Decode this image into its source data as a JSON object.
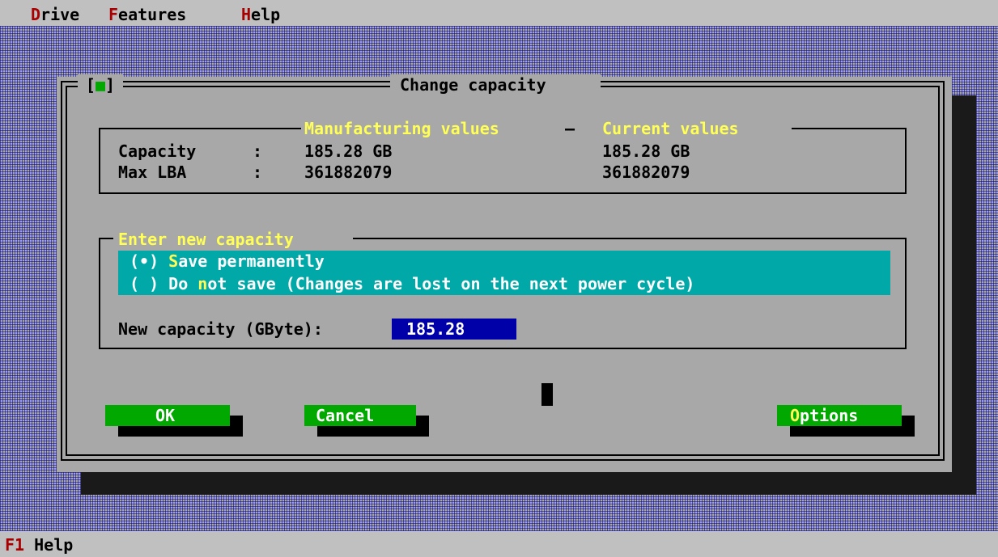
{
  "menu": {
    "drive": {
      "hot": "D",
      "rest": "rive"
    },
    "features": {
      "hot": "F",
      "rest": "eatures"
    },
    "help": {
      "hot": "H",
      "rest": "elp"
    }
  },
  "dialog": {
    "title": "Change capacity",
    "close_open": "[",
    "close_dot": "■",
    "close_close": "]",
    "info": {
      "col_manufacturing": "Manufacturing values",
      "col_separator": "—",
      "col_current": "Current values",
      "rows": [
        {
          "label": "Capacity",
          "sep": ":",
          "manufacturing": "185.28 GB",
          "current": "185.28 GB"
        },
        {
          "label": "Max LBA",
          "sep": ":",
          "manufacturing": "361882079",
          "current": "361882079"
        }
      ]
    },
    "entry": {
      "legend": "Enter new capacity",
      "options": [
        {
          "mark": "(•)",
          "hot": "S",
          "pre": "",
          "rest": "ave permanently",
          "selected": true
        },
        {
          "mark": "( )",
          "pre": "Do ",
          "hot": "n",
          "rest": "ot save (Changes are lost on the next power cycle)",
          "selected": false
        }
      ],
      "capacity_label": "New capacity (GByte):",
      "capacity_value": "185.28"
    },
    "buttons": {
      "ok": "OK",
      "cancel": "Cancel",
      "options_hot": "O",
      "options_rest": "ptions"
    }
  },
  "status": {
    "key": "F1",
    "label": "Help"
  },
  "colors": {
    "hotkey_red": "#a80000",
    "hotkey_yellow": "#ffff55",
    "button_green": "#00a800",
    "radio_cyan": "#00a8a8",
    "input_blue": "#0000a8"
  }
}
